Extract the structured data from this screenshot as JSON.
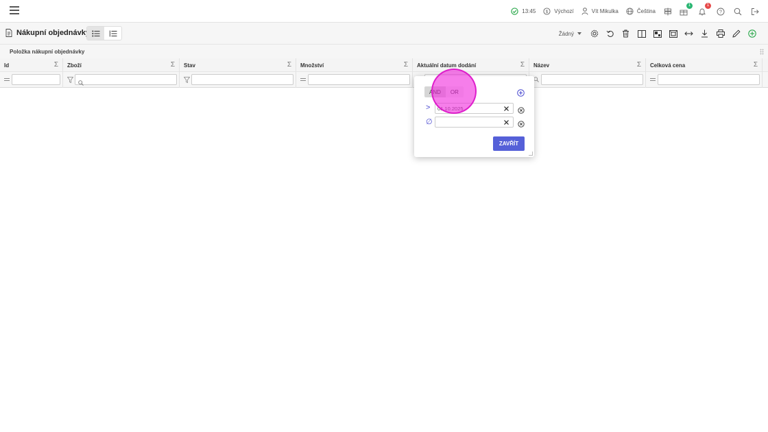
{
  "topbar": {
    "time": "13:45",
    "profile": "Výchozí",
    "user": "Vít Mikulka",
    "language": "Čeština",
    "gifts_badge": "1",
    "notifications_badge": "1",
    "colors": {
      "gift_badge": "#2bb673",
      "notif_badge": "#e64a4a",
      "ok_green": "#29a84a"
    }
  },
  "toolbar": {
    "title": "Nákupní objednávky",
    "view_select": "Žádný",
    "icons": [
      "settings-icon",
      "undo-icon",
      "trash-icon",
      "columns-icon",
      "layout-icon",
      "frame-icon",
      "expand-width-icon",
      "download-icon",
      "print-icon",
      "edit-icon",
      "add-icon"
    ]
  },
  "section": {
    "label": "Položka nákupní objednávky"
  },
  "table": {
    "columns": [
      {
        "label": "Id",
        "filter_op": "=",
        "search": false
      },
      {
        "label": "Zboží",
        "filter_op": "filter",
        "search": true
      },
      {
        "label": "Stav",
        "filter_op": "filter",
        "search": false
      },
      {
        "label": "Množství",
        "filter_op": "=",
        "search": false
      },
      {
        "label": "Aktuální datum dodání",
        "filter_op": "",
        "search": false
      },
      {
        "label": "Název",
        "filter_op": "search",
        "search": false
      },
      {
        "label": "Celková cena",
        "filter_op": "=",
        "search": false
      }
    ],
    "sigma": "Σ"
  },
  "filter_popup": {
    "and_label": "AND",
    "or_label": "OR",
    "conditions": [
      {
        "op": ">",
        "value": "01.10.2025"
      },
      {
        "op": "∅",
        "value": ""
      }
    ],
    "close_label": "ZAVŘÍT",
    "accent": "#5560d8"
  }
}
